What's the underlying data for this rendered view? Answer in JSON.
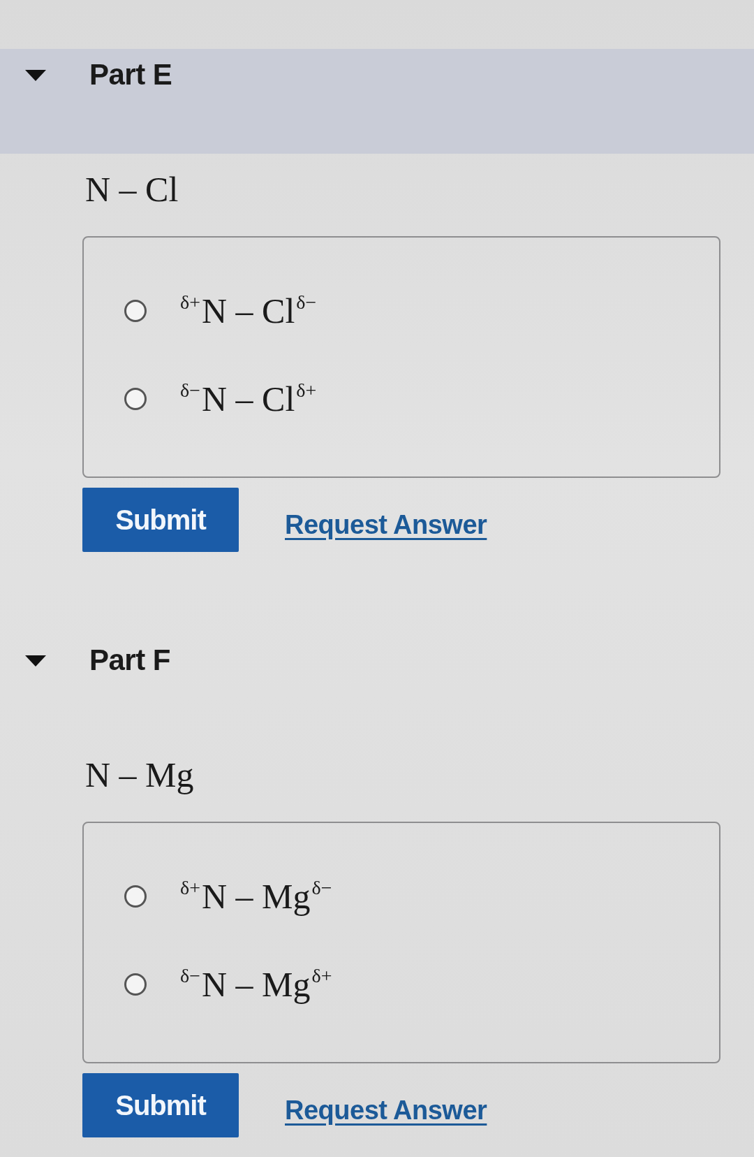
{
  "parts": [
    {
      "title": "Part E",
      "expanded": true,
      "highlighted": true,
      "formula": "N – Cl",
      "options": [
        {
          "label": "$^{δ+}$N – Cl$^{δ−}$",
          "selected": false
        },
        {
          "label": "$^{δ−}$N – Cl$^{δ+}$",
          "selected": false
        }
      ],
      "submit": "Submit",
      "request": "Request Answer"
    },
    {
      "title": "Part F",
      "expanded": true,
      "highlighted": false,
      "formula": "N – Mg",
      "options": [
        {
          "label": "$^{δ+}$N – Mg$^{δ−}$",
          "selected": false
        },
        {
          "label": "$^{δ−}$N – Mg$^{δ+}$",
          "selected": false
        }
      ],
      "submit": "Submit",
      "request": "Request Answer"
    }
  ]
}
